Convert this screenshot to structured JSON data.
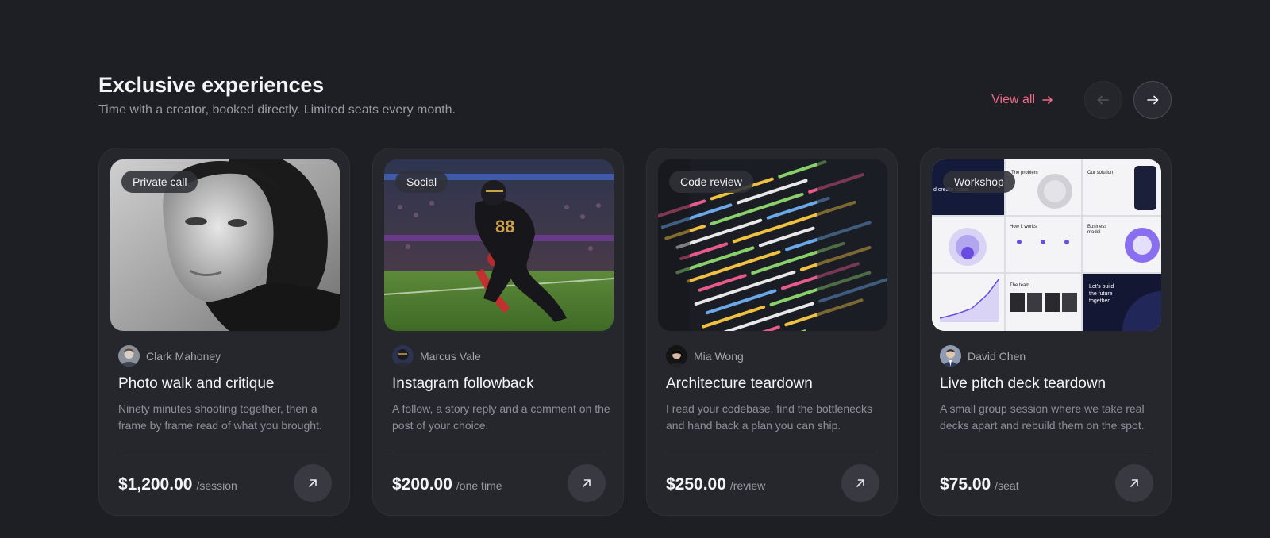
{
  "section": {
    "title": "Exclusive experiences",
    "subtitle": "Time with a creator, booked directly. Limited seats every month.",
    "view_all_label": "View all",
    "accent_color": "#ef6a84"
  },
  "cards": [
    {
      "tag": "Private call",
      "creator": "Clark Mahoney",
      "title": "Photo walk and critique",
      "description": "Ninety minutes shooting together, then a frame by frame read of what you brought.",
      "price": "$1,200.00",
      "unit": "/session"
    },
    {
      "tag": "Social",
      "creator": "Marcus Vale",
      "title": "Instagram followback",
      "description": "A follow, a story reply and a comment on the post of your choice.",
      "price": "$200.00",
      "unit": "/one time"
    },
    {
      "tag": "Code review",
      "creator": "Mia Wong",
      "title": "Architecture teardown",
      "description": "I read your codebase, find the bottlenecks and hand back a plan you can ship.",
      "price": "$250.00",
      "unit": "/review"
    },
    {
      "tag": "Workshop",
      "creator": "David Chen",
      "title": "Live pitch deck teardown",
      "description": "A small group session where we take real decks apart and rebuild them on the spot.",
      "price": "$75.00",
      "unit": "/seat"
    }
  ],
  "icons": {
    "view_all": "arrow-right-icon",
    "prev": "arrow-left-icon",
    "next": "arrow-right-icon",
    "card_action": "arrow-up-right-icon"
  }
}
